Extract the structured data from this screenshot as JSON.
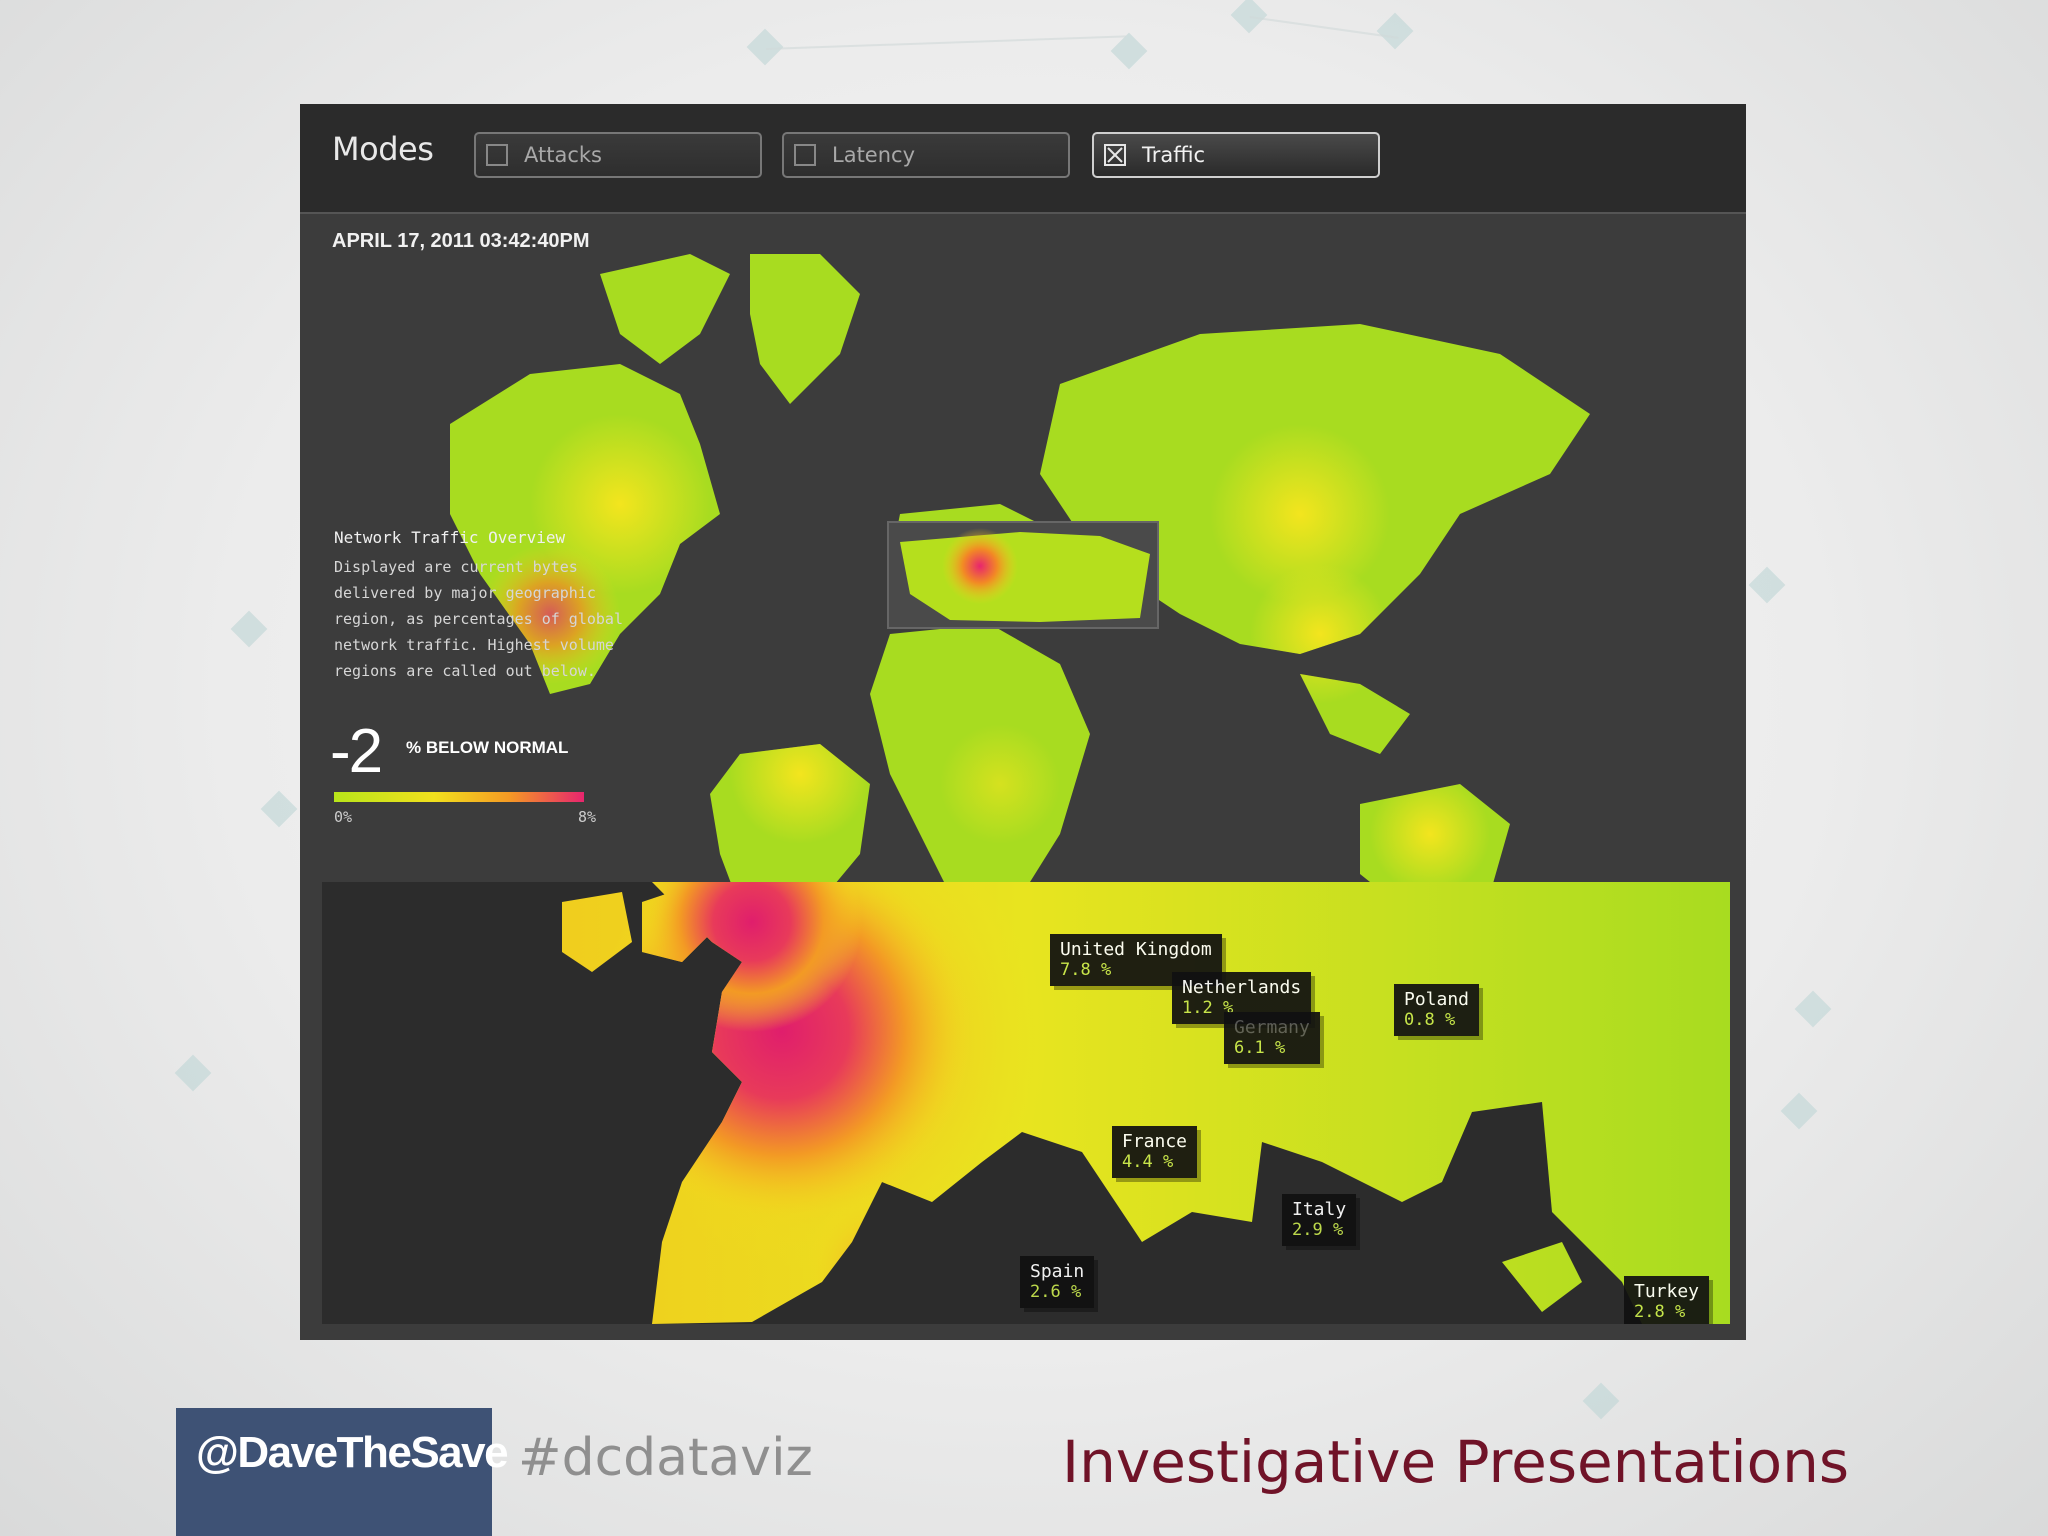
{
  "toolbar": {
    "title": "Modes",
    "modes": [
      {
        "label": "Attacks",
        "checked": false
      },
      {
        "label": "Latency",
        "checked": false
      },
      {
        "label": "Traffic",
        "checked": true
      }
    ]
  },
  "map": {
    "timestamp": "APRIL 17, 2011 03:42:40PM",
    "overview_title": "Network Traffic Overview",
    "overview_text": "Displayed are current bytes delivered by major geographic region, as percentages of global network traffic. Highest volume regions are called out below.",
    "delta_value": "-2",
    "delta_label": "% BELOW NORMAL",
    "legend_min": "0%",
    "legend_max": "8%",
    "legend_colors": [
      "#b8e51a",
      "#f1e01d",
      "#f59a24",
      "#e8256e"
    ]
  },
  "callouts": [
    {
      "name": "United Kingdom",
      "value": "7.8 %"
    },
    {
      "name": "Netherlands",
      "value": "1.2 %"
    },
    {
      "name": "Germany",
      "value": "6.1 %"
    },
    {
      "name": "Poland",
      "value": "0.8 %"
    },
    {
      "name": "France",
      "value": "4.4 %"
    },
    {
      "name": "Italy",
      "value": "2.9 %"
    },
    {
      "name": "Spain",
      "value": "2.6 %"
    },
    {
      "name": "Turkey",
      "value": "2.8 %"
    }
  ],
  "footer": {
    "handle": "@DaveTheSave",
    "hashtag": "#dcdataviz",
    "title": "Investigative Presentations"
  },
  "icons": [
    "checkbox-empty-icon",
    "checkbox-checked-icon"
  ]
}
